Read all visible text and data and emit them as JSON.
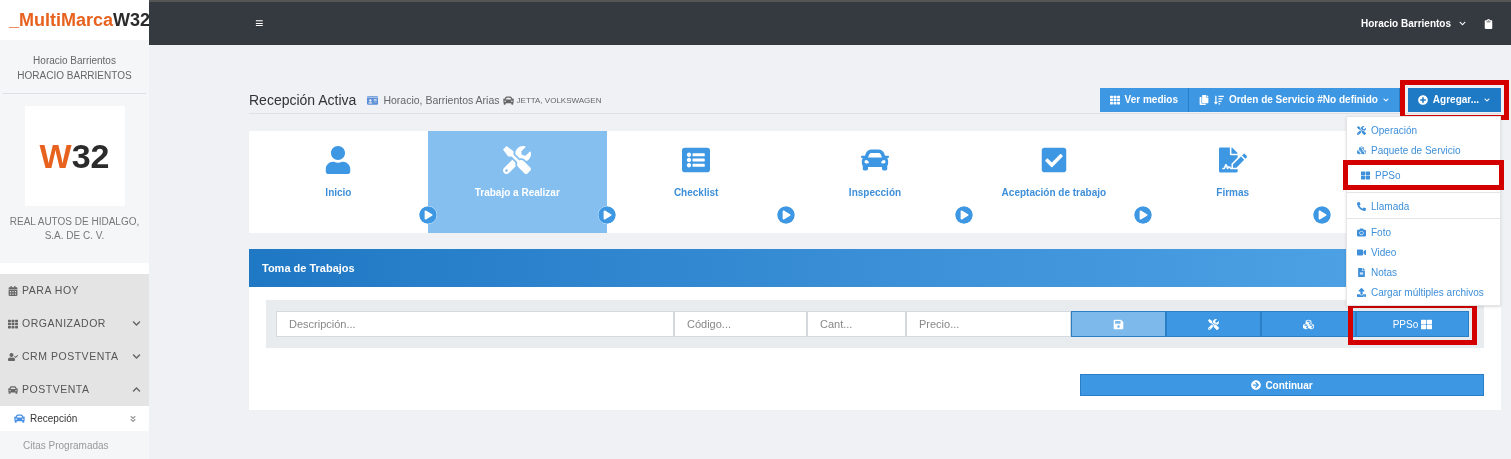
{
  "brand": {
    "accent": "_MultiMarca",
    "rest": "W32"
  },
  "topbar": {
    "menu_glyph": "≡",
    "user": "Horacio Barrientos"
  },
  "sidebar": {
    "user_name": "Horacio Barrientos",
    "user_upper": "HORACIO BARRIENTOS",
    "logo": {
      "accent": "W",
      "rest": "32"
    },
    "company": "REAL AUTOS DE HIDALGO, S.A. DE C. V.",
    "items": [
      {
        "label": "PARA HOY",
        "kind": "link"
      },
      {
        "label": "ORGANIZADOR",
        "kind": "group",
        "expanded": false
      },
      {
        "label": "CRM POSTVENTA",
        "kind": "group",
        "expanded": false
      },
      {
        "label": "POSTVENTA",
        "kind": "group",
        "expanded": true,
        "children": [
          {
            "label": "Recepción",
            "selected": true
          },
          {
            "label": "Citas Programadas",
            "selected": false
          }
        ]
      }
    ]
  },
  "page": {
    "title": "Recepción Activa",
    "client": "Horacio, Barrientos Arias",
    "vehicle": "JETTA, VOLKSWAGEN"
  },
  "toolbar": [
    {
      "label": "Ver medios",
      "kind": "media",
      "highlighted": false
    },
    {
      "label": "Orden de Servicio #No definido",
      "kind": "order",
      "highlighted": false
    },
    {
      "label": "Agregar...",
      "kind": "add",
      "highlighted": true
    }
  ],
  "steps": [
    {
      "label": "Inicio",
      "selected": false
    },
    {
      "label": "Trabajo a Realizar",
      "selected": true
    },
    {
      "label": "Checklist",
      "selected": false
    },
    {
      "label": "Inspección",
      "selected": false
    },
    {
      "label": "Aceptación de trabajo",
      "selected": false
    },
    {
      "label": "Firmas",
      "selected": false
    }
  ],
  "add_menu": [
    [
      {
        "label": "Operación",
        "kind": "tools",
        "highlighted": false
      },
      {
        "label": "Paquete de Servicio",
        "kind": "cubes",
        "highlighted": false
      },
      {
        "label": "PPSo",
        "kind": "grid",
        "highlighted": true
      }
    ],
    [
      {
        "label": "Llamada",
        "kind": "phone",
        "highlighted": false
      }
    ],
    [
      {
        "label": "Foto",
        "kind": "camera",
        "highlighted": false
      },
      {
        "label": "Video",
        "kind": "video",
        "highlighted": false
      },
      {
        "label": "Notas",
        "kind": "file",
        "highlighted": false
      },
      {
        "label": "Cargar múltiples archivos",
        "kind": "upload",
        "highlighted": false
      }
    ]
  ],
  "panel": {
    "title": "Toma de Trabajos",
    "fields": [
      {
        "placeholder": "Descripción..."
      },
      {
        "placeholder": "Código..."
      },
      {
        "placeholder": "Cant..."
      },
      {
        "placeholder": "Precio..."
      }
    ],
    "actions": [
      {
        "kind": "save",
        "disabled": true,
        "highlighted": false
      },
      {
        "kind": "tools",
        "disabled": false,
        "highlighted": false
      },
      {
        "kind": "cubes",
        "disabled": false,
        "highlighted": false
      },
      {
        "kind": "ppso",
        "label": "PPSo",
        "disabled": false,
        "highlighted": true
      }
    ],
    "continue_label": "Continuar"
  }
}
